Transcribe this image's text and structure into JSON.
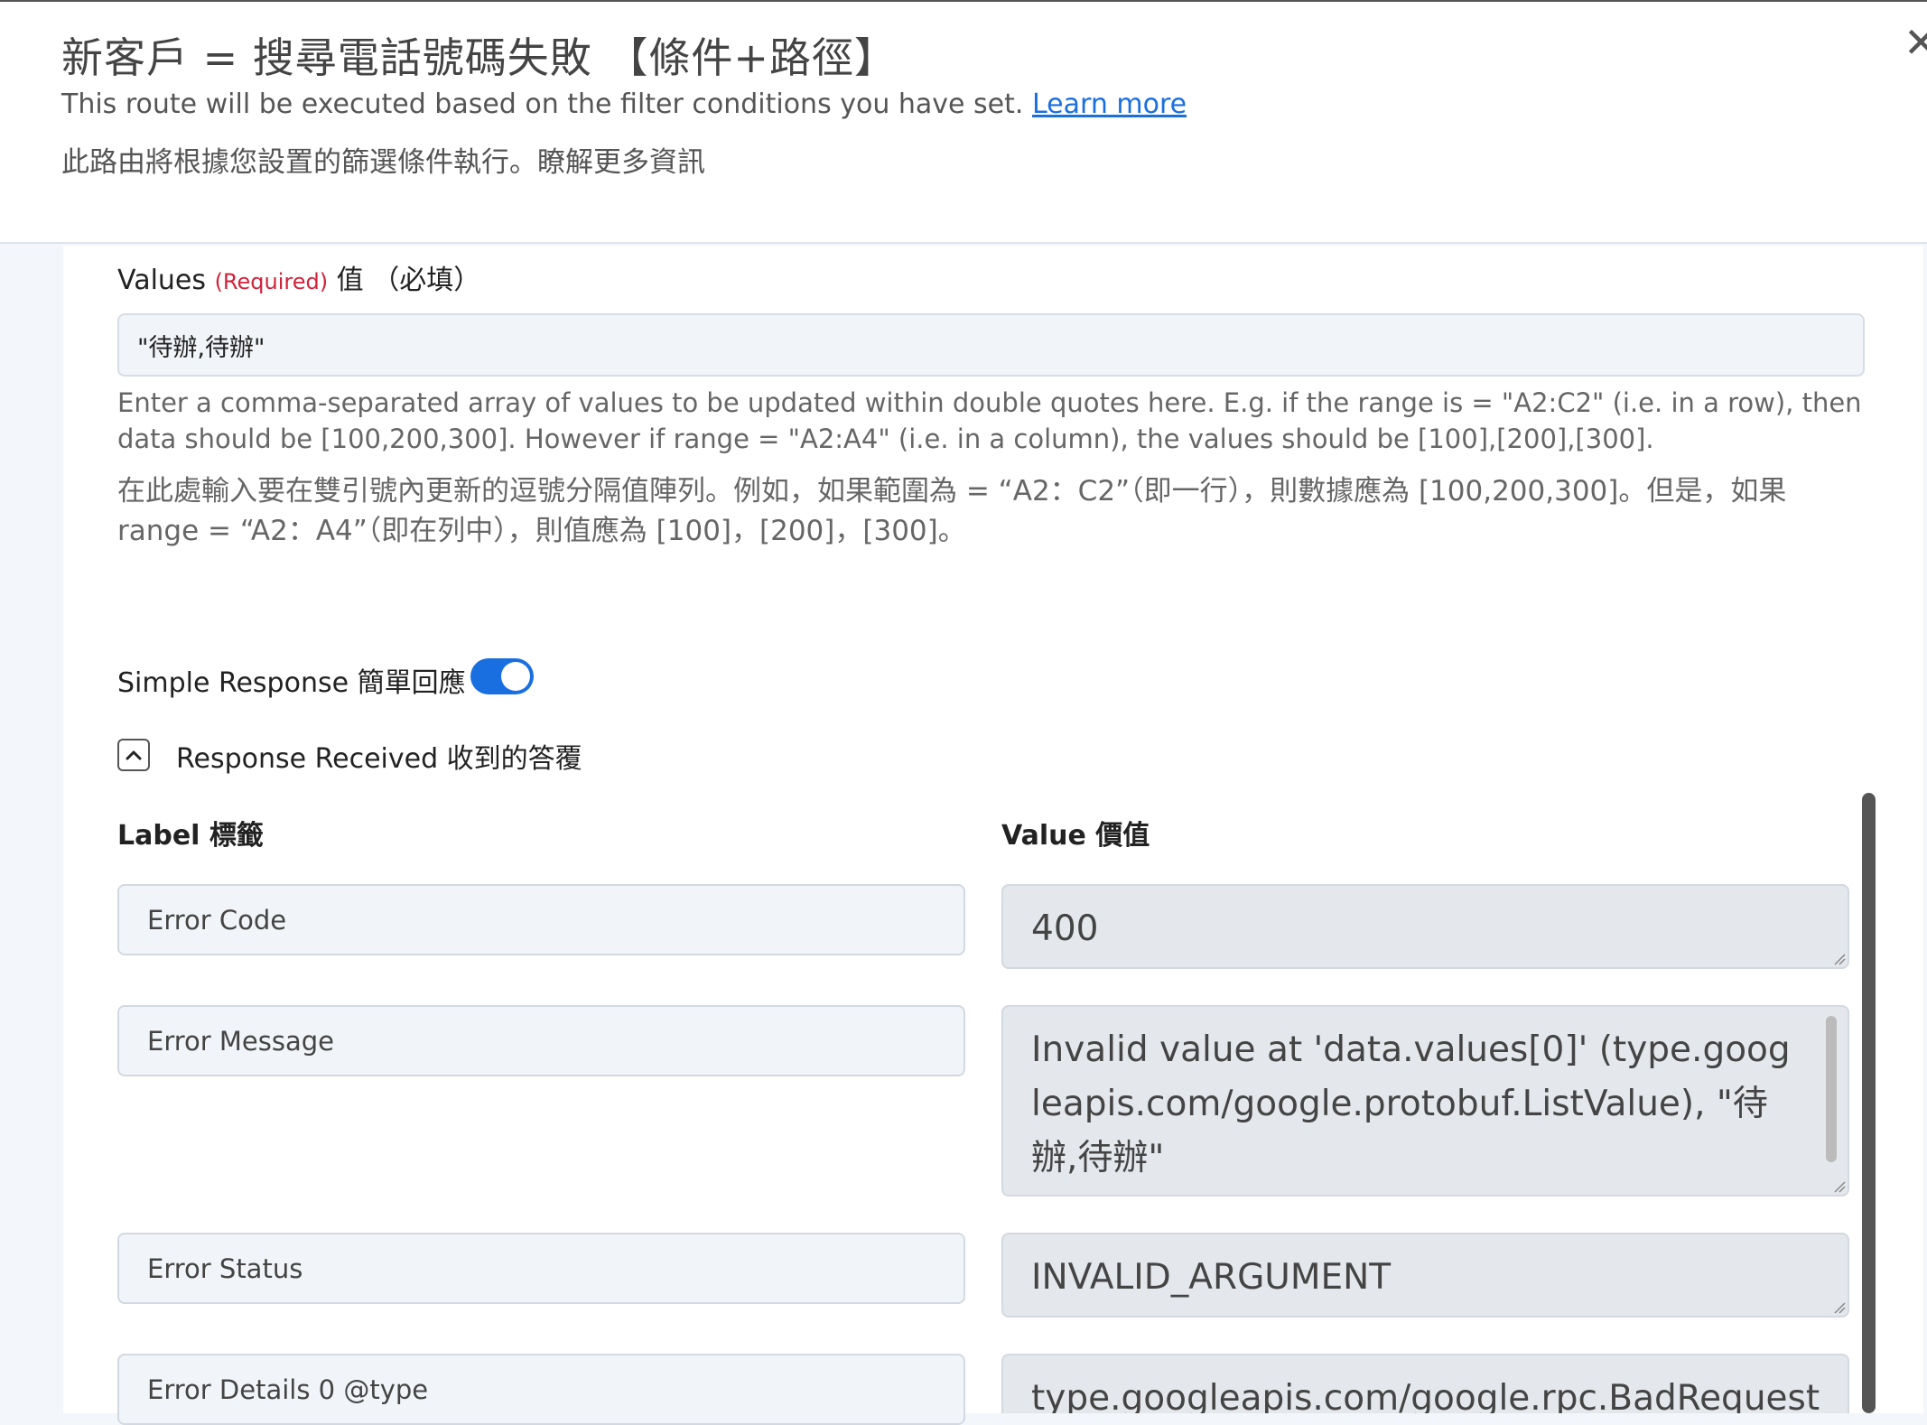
{
  "header": {
    "title": "新客戶 = 搜尋電話號碼失敗 【條件+路徑】",
    "subtitle": "This route will be executed based on the filter conditions you have set.",
    "learn_more": "Learn more",
    "subtitle_zh": "此路由將根據您設置的篩選條件執行。瞭解更多資訊"
  },
  "values_field": {
    "label": "Values",
    "required": "(Required)",
    "label_zh": "值 （必填）",
    "value": "\"待辦,待辦\"",
    "help": "Enter a comma-separated array of values to be updated within double quotes here. E.g. if the range is = \"A2:C2\" (i.e. in a row), then data should be [100,200,300]. However if range = \"A2:A4\" (i.e. in a column), the values should be [100],[200],[300].",
    "help_zh": "在此處輸入要在雙引號內更新的逗號分隔值陣列。例如，如果範圍為 = “A2：C2”（即一行），則數據應為 [100,200,300]。但是，如果 range = “A2：A4”（即在列中），則值應為 [100]，[200]，[300]。"
  },
  "simple_response": {
    "label": "Simple Response  簡單回應",
    "enabled": true
  },
  "response_received": {
    "label": "Response Received  收到的答覆",
    "label_header": "Label 標籤",
    "value_header": "Value 價值",
    "rows": [
      {
        "label": "Error Code",
        "value": "400"
      },
      {
        "label": "Error Message",
        "value": "Invalid value at 'data.values[0]' (type.googleapis.com/google.protobuf.ListValue), \"待辦,待辦\""
      },
      {
        "label": "Error Status",
        "value": "INVALID_ARGUMENT"
      },
      {
        "label": "Error Details 0 @type",
        "value": "type.googleapis.com/google.rpc.BadRequest"
      }
    ]
  },
  "icons": {
    "close": "close-icon",
    "collapse": "chevron-up-icon"
  },
  "colors": {
    "accent": "#1a6fe0",
    "required": "#d0233a"
  }
}
